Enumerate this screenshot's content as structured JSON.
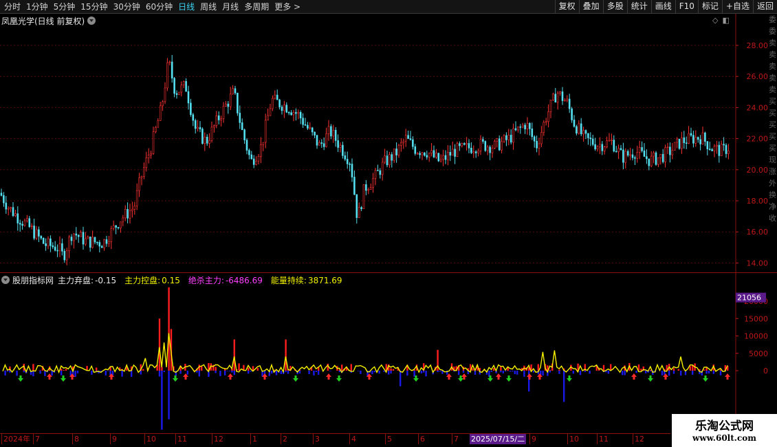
{
  "toolbar": {
    "periods": [
      "分时",
      "1分钟",
      "5分钟",
      "15分钟",
      "30分钟",
      "60分钟",
      "日线",
      "周线",
      "月线",
      "多周期",
      "更多 >"
    ],
    "active_period": "日线",
    "tools": [
      "复权",
      "叠加",
      "多股",
      "统计",
      "画线",
      "F10",
      "标记",
      "+自选",
      "返回"
    ]
  },
  "price_chart": {
    "title": "凤凰光学(日线 前复权)",
    "y_ticks": [
      "28.00",
      "26.00",
      "24.00",
      "22.00",
      "20.00",
      "18.00",
      "16.00",
      "14.00"
    ],
    "y_values": [
      28,
      26,
      24,
      22,
      20,
      18,
      16,
      14
    ],
    "colors": {
      "up": "#ff3232",
      "down": "#54e0f0",
      "grid": "#5a0a0a"
    }
  },
  "indicator": {
    "name": "股朋指标网",
    "items": [
      {
        "label": "主力弃盘:",
        "value": "-0.15",
        "color": "#e8e8e8"
      },
      {
        "label": "主力控盘:",
        "value": "0.15",
        "color": "#f0f000"
      },
      {
        "label": "绝杀主力:",
        "value": "-6486.69",
        "color": "#ff40ff"
      },
      {
        "label": "能量持续:",
        "value": "3871.69",
        "color": "#f0f000"
      }
    ],
    "y_ticks": [
      "20000",
      "15000",
      "10000",
      "5000",
      "0"
    ],
    "y_values": [
      20000,
      15000,
      10000,
      5000,
      0
    ],
    "cursor_value": "21056"
  },
  "dates": {
    "labels": [
      "2024年",
      "7",
      "8",
      "9",
      "10",
      "11",
      "12",
      "1",
      "2",
      "3",
      "4",
      "5",
      "6",
      "7",
      "9",
      "10",
      "11",
      "12"
    ],
    "cursor_date": "2025/07/15/二"
  },
  "watermark": {
    "title": "乐淘公式网",
    "url": "www.60lt.com"
  },
  "side_strip": [
    "委",
    "委",
    "卖",
    "卖",
    "卖",
    "卖",
    "卖",
    "买",
    "买",
    "买",
    "买",
    "买",
    "现",
    "涨",
    "外",
    "换",
    "净",
    "收"
  ]
}
